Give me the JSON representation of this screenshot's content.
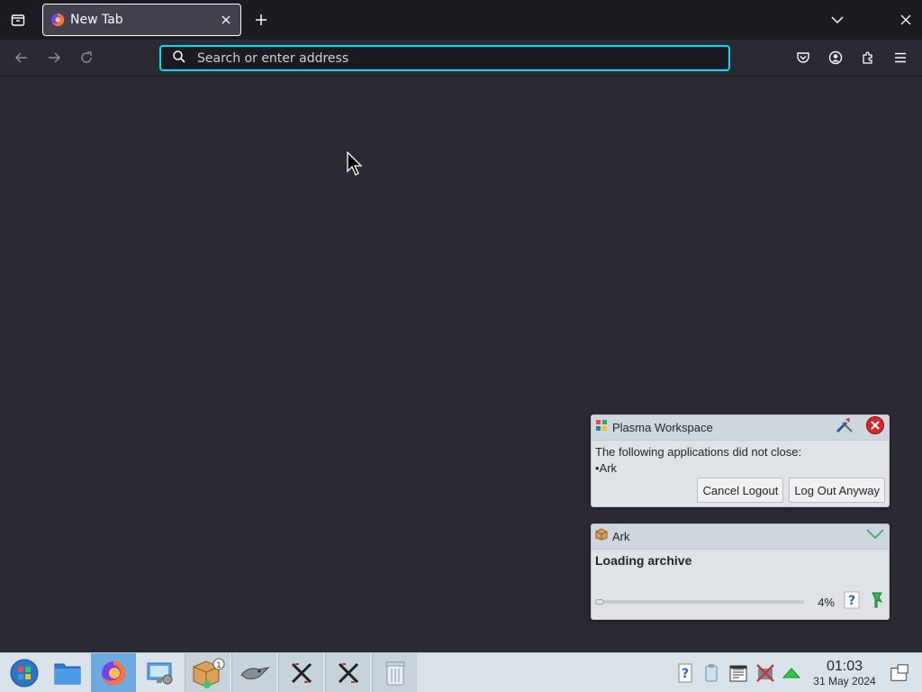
{
  "browser": {
    "tab": {
      "title": "New Tab"
    },
    "urlbar": {
      "placeholder": "Search or enter address",
      "value": ""
    }
  },
  "notifications": [
    {
      "app": "Plasma Workspace",
      "body_line1": "The following applications did not close:",
      "body_line2": "•Ark",
      "actions": [
        "Cancel Logout",
        "Log Out Anyway"
      ]
    },
    {
      "app": "Ark",
      "title": "Loading archive",
      "progress_percent": 4,
      "progress_label": "4%"
    }
  ],
  "taskbar": {
    "items": [
      "start-menu",
      "file-manager",
      "firefox",
      "system-settings",
      "ark",
      "gimp",
      "xorg-app-1",
      "xorg-app-2",
      "trash"
    ],
    "clock": {
      "time": "01:03",
      "date": "31 May 2024"
    }
  },
  "colors": {
    "accent": "#00ddff",
    "background": "#2b2a33",
    "tabstrip": "#1c1b22"
  }
}
